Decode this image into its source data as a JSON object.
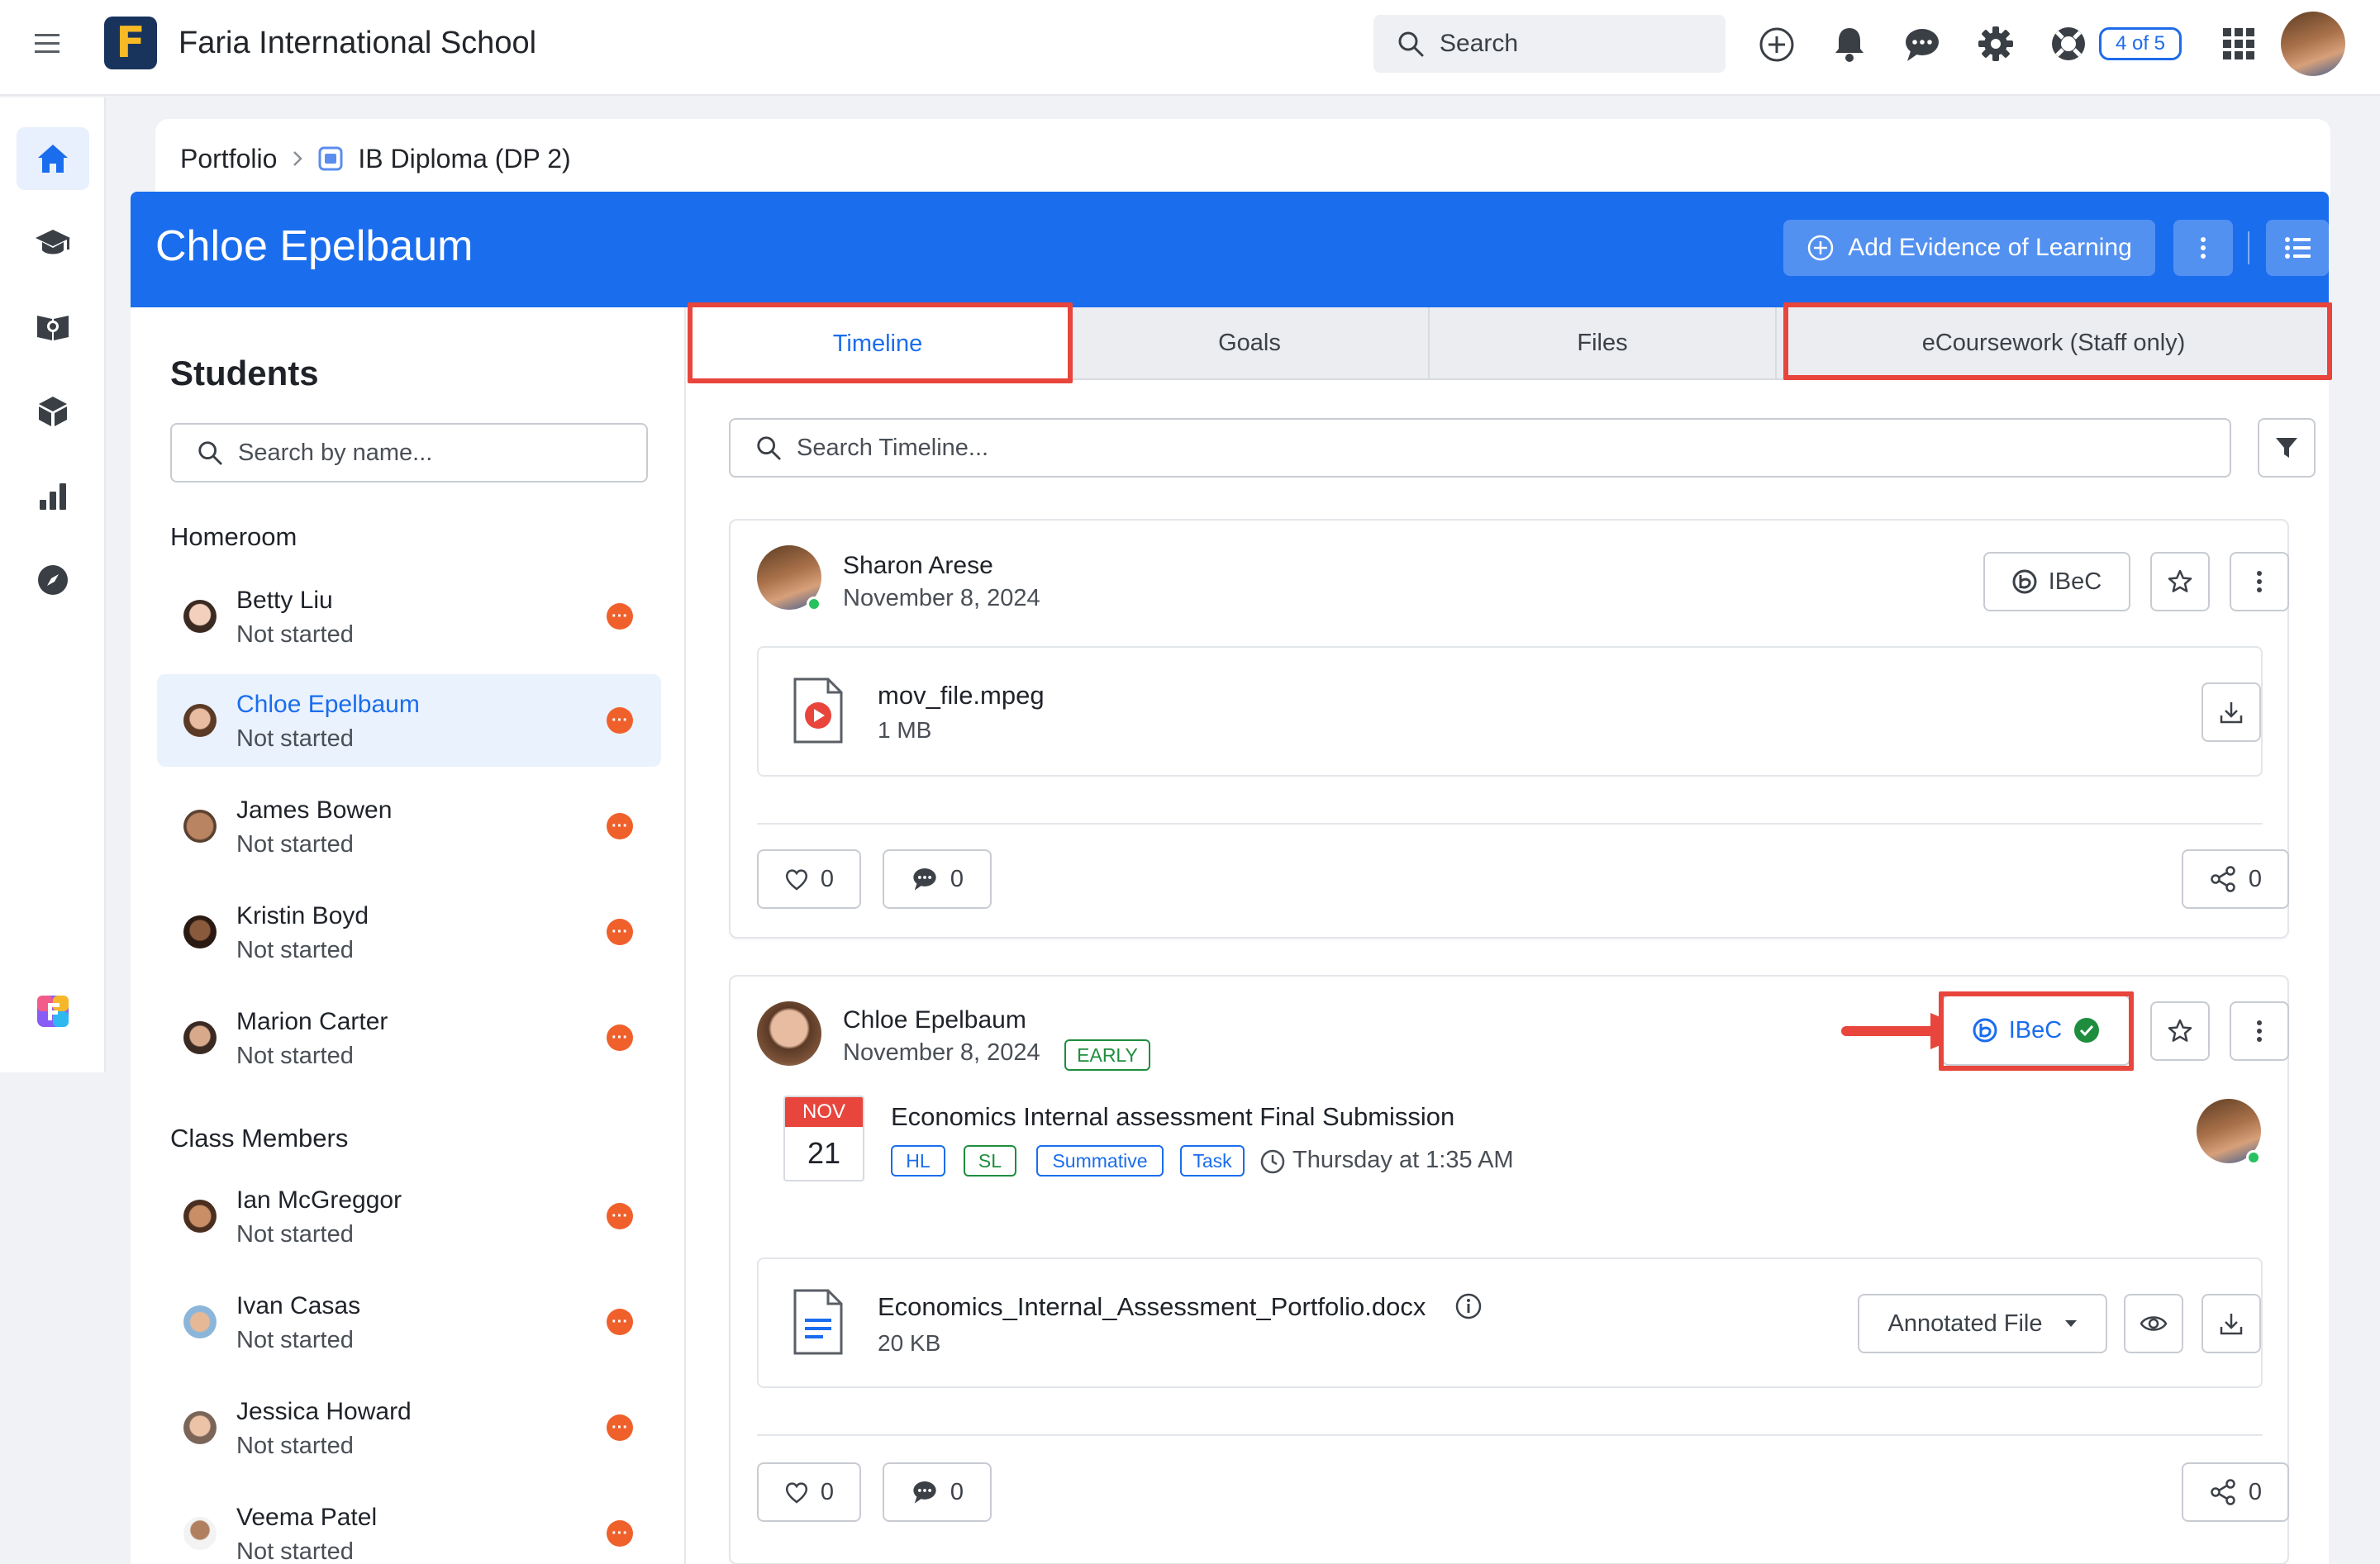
{
  "app": {
    "school_name": "Faria International School",
    "logo_letter": "F",
    "search_placeholder": "Search",
    "count_badge": "4 of 5"
  },
  "breadcrumb": {
    "root": "Portfolio",
    "current": "IB Diploma (DP 2)"
  },
  "header": {
    "student_name": "Chloe Epelbaum",
    "add_evidence_label": "Add Evidence of Learning"
  },
  "students_panel": {
    "title": "Students",
    "search_placeholder": "Search by name...",
    "homeroom_label": "Homeroom",
    "class_members_label": "Class Members",
    "homeroom": [
      {
        "name": "Betty Liu",
        "status": "Not started"
      },
      {
        "name": "Chloe Epelbaum",
        "status": "Not started"
      },
      {
        "name": "James Bowen",
        "status": "Not started"
      },
      {
        "name": "Kristin Boyd",
        "status": "Not started"
      },
      {
        "name": "Marion Carter",
        "status": "Not started"
      }
    ],
    "class_members": [
      {
        "name": "Ian McGreggor",
        "status": "Not started"
      },
      {
        "name": "Ivan Casas",
        "status": "Not started"
      },
      {
        "name": "Jessica Howard",
        "status": "Not started"
      },
      {
        "name": "Veema Patel",
        "status": "Not started"
      }
    ],
    "status_dot_glyph": "···"
  },
  "tabs": {
    "timeline": "Timeline",
    "goals": "Goals",
    "files": "Files",
    "ecoursework": "eCoursework (Staff only)"
  },
  "timeline": {
    "search_placeholder": "Search Timeline...",
    "posts": [
      {
        "author": "Sharon Arese",
        "date": "November 8, 2024",
        "ibec_label": "IBeC",
        "file": {
          "name": "mov_file.mpeg",
          "size": "1 MB"
        },
        "likes": "0",
        "comments": "0",
        "shares": "0"
      },
      {
        "author": "Chloe Epelbaum",
        "date": "November 8, 2024",
        "badge": "EARLY",
        "ibec_label": "IBeC",
        "task": {
          "month": "NOV",
          "day": "21",
          "title": "Economics Internal assessment Final Submission",
          "tags": [
            "HL",
            "SL",
            "Summative",
            "Task"
          ],
          "due": "Thursday at 1:35 AM"
        },
        "file": {
          "name": "Economics_Internal_Assessment_Portfolio.docx",
          "size": "20 KB",
          "action": "Annotated File"
        },
        "likes": "0",
        "comments": "0",
        "shares": "0"
      }
    ]
  },
  "colors": {
    "brand_blue": "#1a6ded",
    "highlight_red": "#e8453c",
    "status_orange": "#f0602b",
    "success_green": "#1e8e3e"
  }
}
